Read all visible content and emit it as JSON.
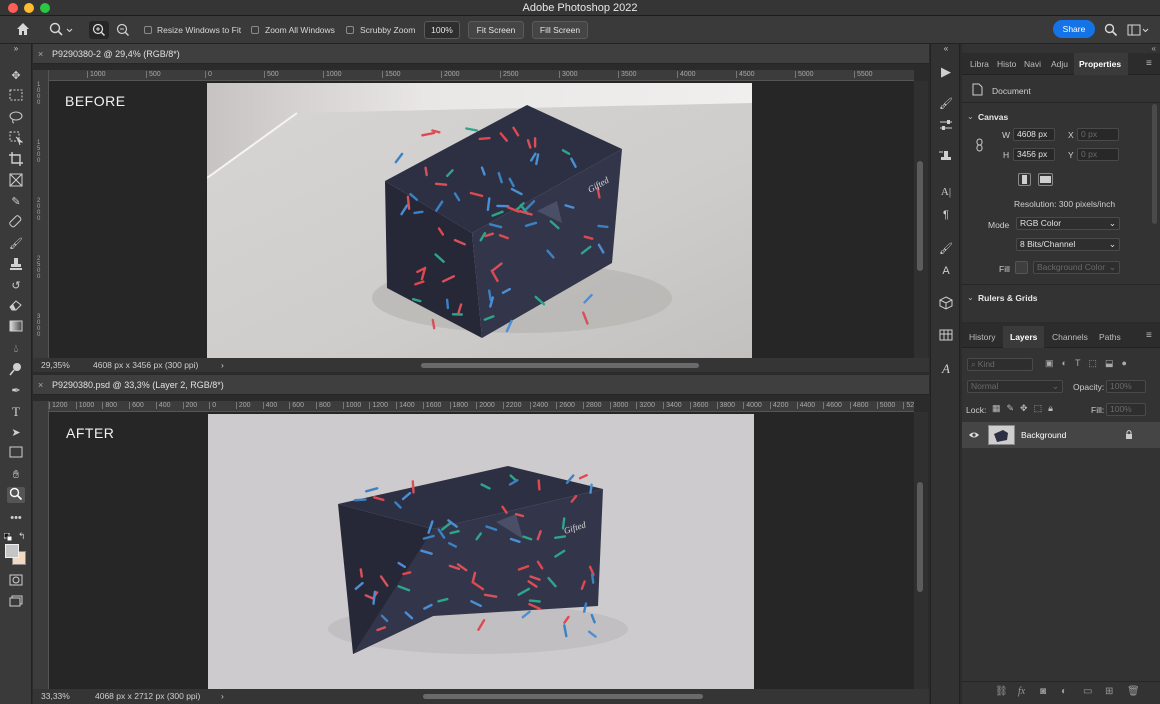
{
  "window": {
    "title": "Adobe Photoshop 2022"
  },
  "options_bar": {
    "resize_windows": "Resize Windows to Fit",
    "zoom_all": "Zoom All Windows",
    "scrubby_zoom": "Scrubby Zoom",
    "zoom_value": "100%",
    "fit_screen": "Fit Screen",
    "fill_screen": "Fill Screen",
    "share": "Share"
  },
  "doc1": {
    "tab": "P9290380-2 @ 29,4% (RGB/8*)",
    "label": "BEFORE",
    "zoom": "29,35%",
    "info": "4608 px x 3456 px (300 ppi)",
    "ruler": [
      "1000",
      "500",
      "0",
      "500",
      "1000",
      "1500",
      "2000",
      "2500",
      "3000",
      "3500",
      "4000",
      "4500",
      "5000",
      "5500"
    ],
    "vruler": [
      "1000",
      "1500",
      "2000",
      "2500",
      "3000"
    ]
  },
  "doc2": {
    "tab": "P9290380.psd @ 33,3% (Layer 2, RGB/8*)",
    "label": "AFTER",
    "zoom": "33,33%",
    "info": "4068 px x 2712 px (300 ppi)",
    "ruler": [
      "1200",
      "1000",
      "800",
      "600",
      "400",
      "200",
      "0",
      "200",
      "400",
      "600",
      "800",
      "1000",
      "1200",
      "1400",
      "1600",
      "1800",
      "2000",
      "2200",
      "2400",
      "2600",
      "2800",
      "3000",
      "3200",
      "3400",
      "3600",
      "3800",
      "4000",
      "4200",
      "4400",
      "4600",
      "4800",
      "5000",
      "5200"
    ]
  },
  "properties": {
    "tabs": [
      "Libra",
      "Histo",
      "Navi",
      "Adju",
      "Properties"
    ],
    "document": "Document",
    "canvas_header": "Canvas",
    "w_label": "W",
    "w_value": "4608 px",
    "h_label": "H",
    "h_value": "3456 px",
    "x_label": "X",
    "x_value": "0 px",
    "y_label": "Y",
    "y_value": "0 px",
    "resolution": "Resolution: 300 pixels/inch",
    "mode_label": "Mode",
    "mode_value": "RGB Color",
    "bits_value": "8 Bits/Channel",
    "fill_label": "Fill",
    "fill_value": "Background Color",
    "rulers_header": "Rulers & Grids"
  },
  "layers": {
    "tabs": [
      "History",
      "Layers",
      "Channels",
      "Paths"
    ],
    "kind": "Kind",
    "blend": "Normal",
    "opacity_label": "Opacity:",
    "opacity_value": "100%",
    "lock_label": "Lock:",
    "fill_label": "Fill:",
    "fill_value": "100%",
    "layer_name": "Background"
  },
  "colors": {
    "accent": "#1473e6",
    "box": "#2e3142"
  }
}
